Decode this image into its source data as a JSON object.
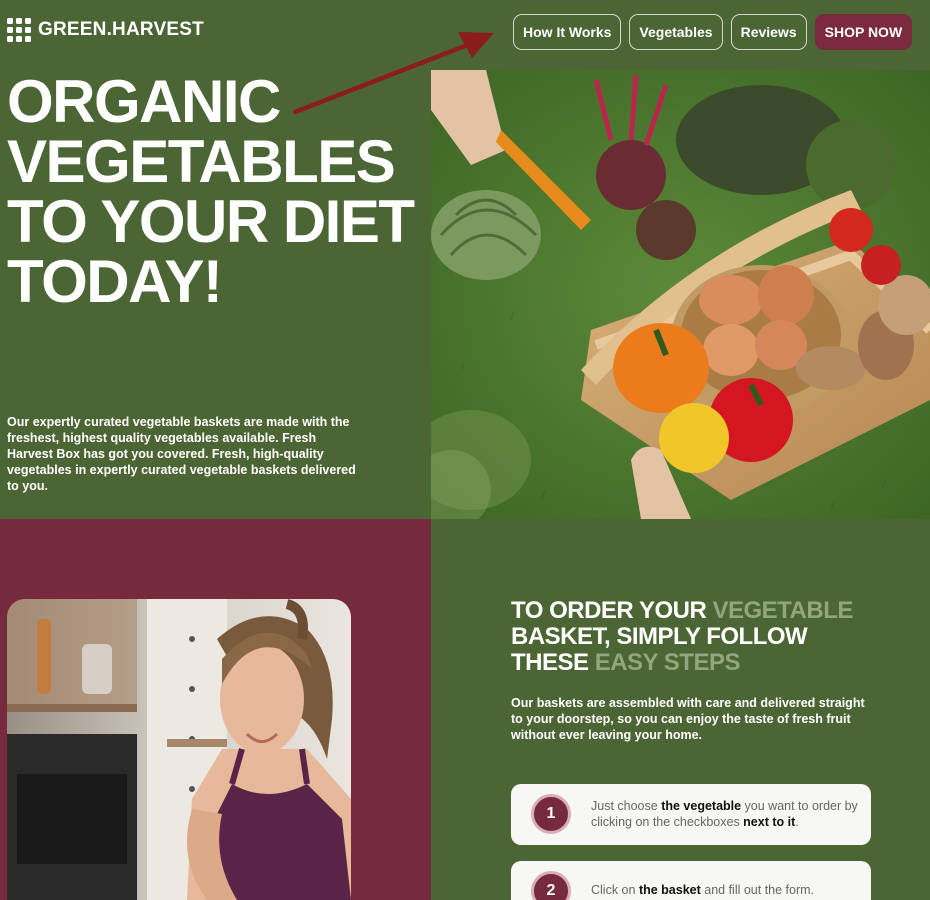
{
  "brand": {
    "name": "GREEN.HARVEST"
  },
  "nav": {
    "items": [
      "How It Works",
      "Vegetables",
      "Reviews"
    ],
    "cta": "SHOP NOW"
  },
  "hero": {
    "title_lines": [
      "ORGANIC",
      "VEGETABLES",
      "TO YOUR DIET",
      "TODAY!"
    ],
    "description": "Our expertly curated vegetable baskets are made with the freshest, highest quality vegetables available. Fresh Harvest Box has got you covered. Fresh, high-quality vegetables in expertly curated vegetable baskets delivered to you."
  },
  "steps_section": {
    "title_parts": [
      {
        "text": "TO ORDER YOUR ",
        "muted": false
      },
      {
        "text": "VEGETABLE",
        "muted": true
      },
      {
        "text": " BASKET, SIMPLY FOLLOW THESE ",
        "muted": false
      },
      {
        "text": "EASY STEPS",
        "muted": true
      }
    ],
    "description": "Our baskets are assembled with care and delivered straight to your doorstep, so you can enjoy the taste of fresh fruit without ever leaving your home.",
    "steps": [
      {
        "number": "1",
        "parts": [
          {
            "text": "Just choose ",
            "bold": false
          },
          {
            "text": "the vegetable",
            "bold": true
          },
          {
            "text": " you want to order by clicking on the checkboxes ",
            "bold": false
          },
          {
            "text": "next to it",
            "bold": true
          },
          {
            "text": ".",
            "bold": false
          }
        ]
      },
      {
        "number": "2",
        "parts": [
          {
            "text": "Click on ",
            "bold": false
          },
          {
            "text": "the basket",
            "bold": true
          },
          {
            "text": " and fill out the form.",
            "bold": false
          }
        ]
      }
    ]
  },
  "colors": {
    "green": "#4c6534",
    "maroon": "#752a3e",
    "cta": "#7b2a3f",
    "annotation_arrow": "#8b1c1c"
  },
  "icons": [
    "logo-grid-icon",
    "annotation-arrow"
  ]
}
